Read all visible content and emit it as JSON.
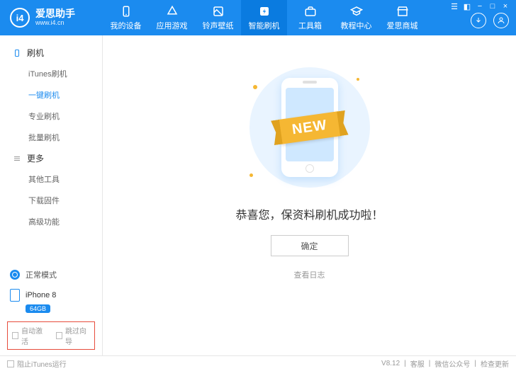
{
  "app": {
    "name_cn": "爱思助手",
    "name_en": "www.i4.cn",
    "logo_text": "i4"
  },
  "tabs": [
    {
      "label": "我的设备"
    },
    {
      "label": "应用游戏"
    },
    {
      "label": "铃声壁纸"
    },
    {
      "label": "智能刷机"
    },
    {
      "label": "工具箱"
    },
    {
      "label": "教程中心"
    },
    {
      "label": "爱思商城"
    }
  ],
  "sidebar": {
    "group1": {
      "title": "刷机",
      "items": [
        {
          "label": "iTunes刷机"
        },
        {
          "label": "一键刷机"
        },
        {
          "label": "专业刷机"
        },
        {
          "label": "批量刷机"
        }
      ]
    },
    "group2": {
      "title": "更多",
      "items": [
        {
          "label": "其他工具"
        },
        {
          "label": "下载固件"
        },
        {
          "label": "高级功能"
        }
      ]
    }
  },
  "mode": {
    "label": "正常模式"
  },
  "device": {
    "name": "iPhone 8",
    "storage": "64GB"
  },
  "options": {
    "auto_activate": "自动激活",
    "skip_guide": "跳过向导"
  },
  "result": {
    "ribbon": "NEW",
    "message": "恭喜您，保资料刷机成功啦！",
    "ok": "确定",
    "log": "查看日志"
  },
  "footer": {
    "block_itunes": "阻止iTunes运行",
    "version": "V8.12",
    "links": [
      "客服",
      "微信公众号",
      "检查更新"
    ]
  }
}
